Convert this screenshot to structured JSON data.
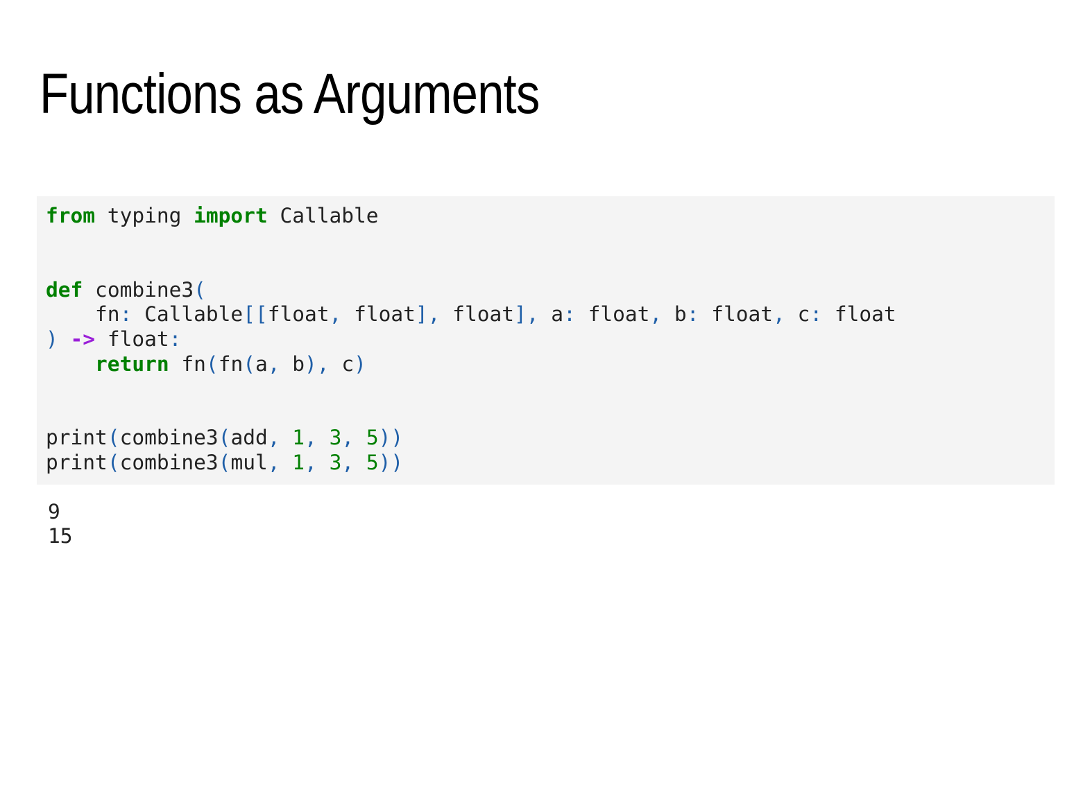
{
  "slide": {
    "title": "Functions as Arguments"
  },
  "code": {
    "lines": [
      [
        {
          "text": "from",
          "cls": "kw"
        },
        {
          "text": " typing ",
          "cls": ""
        },
        {
          "text": "import",
          "cls": "kw"
        },
        {
          "text": " Callable",
          "cls": ""
        }
      ],
      [],
      [],
      [
        {
          "text": "def",
          "cls": "kw"
        },
        {
          "text": " combine3",
          "cls": ""
        },
        {
          "text": "(",
          "cls": "p"
        }
      ],
      [
        {
          "text": "    fn",
          "cls": ""
        },
        {
          "text": ":",
          "cls": "p"
        },
        {
          "text": " Callable",
          "cls": ""
        },
        {
          "text": "[[",
          "cls": "p"
        },
        {
          "text": "float",
          "cls": ""
        },
        {
          "text": ",",
          "cls": "p"
        },
        {
          "text": " float",
          "cls": ""
        },
        {
          "text": "],",
          "cls": "p"
        },
        {
          "text": " float",
          "cls": ""
        },
        {
          "text": "],",
          "cls": "p"
        },
        {
          "text": " a",
          "cls": ""
        },
        {
          "text": ":",
          "cls": "p"
        },
        {
          "text": " float",
          "cls": ""
        },
        {
          "text": ",",
          "cls": "p"
        },
        {
          "text": " b",
          "cls": ""
        },
        {
          "text": ":",
          "cls": "p"
        },
        {
          "text": " float",
          "cls": ""
        },
        {
          "text": ",",
          "cls": "p"
        },
        {
          "text": " c",
          "cls": ""
        },
        {
          "text": ":",
          "cls": "p"
        },
        {
          "text": " float",
          "cls": ""
        }
      ],
      [
        {
          "text": ")",
          "cls": "p"
        },
        {
          "text": " ",
          "cls": ""
        },
        {
          "text": "->",
          "cls": "op"
        },
        {
          "text": " float",
          "cls": ""
        },
        {
          "text": ":",
          "cls": "p"
        }
      ],
      [
        {
          "text": "    ",
          "cls": ""
        },
        {
          "text": "return",
          "cls": "kw"
        },
        {
          "text": " fn",
          "cls": ""
        },
        {
          "text": "(",
          "cls": "p"
        },
        {
          "text": "fn",
          "cls": ""
        },
        {
          "text": "(",
          "cls": "p"
        },
        {
          "text": "a",
          "cls": ""
        },
        {
          "text": ",",
          "cls": "p"
        },
        {
          "text": " b",
          "cls": ""
        },
        {
          "text": "),",
          "cls": "p"
        },
        {
          "text": " c",
          "cls": ""
        },
        {
          "text": ")",
          "cls": "p"
        }
      ],
      [],
      [],
      [
        {
          "text": "print",
          "cls": ""
        },
        {
          "text": "(",
          "cls": "p"
        },
        {
          "text": "combine3",
          "cls": ""
        },
        {
          "text": "(",
          "cls": "p"
        },
        {
          "text": "add",
          "cls": ""
        },
        {
          "text": ",",
          "cls": "p"
        },
        {
          "text": " ",
          "cls": ""
        },
        {
          "text": "1",
          "cls": "num"
        },
        {
          "text": ",",
          "cls": "p"
        },
        {
          "text": " ",
          "cls": ""
        },
        {
          "text": "3",
          "cls": "num"
        },
        {
          "text": ",",
          "cls": "p"
        },
        {
          "text": " ",
          "cls": ""
        },
        {
          "text": "5",
          "cls": "num"
        },
        {
          "text": "))",
          "cls": "p"
        }
      ],
      [
        {
          "text": "print",
          "cls": ""
        },
        {
          "text": "(",
          "cls": "p"
        },
        {
          "text": "combine3",
          "cls": ""
        },
        {
          "text": "(",
          "cls": "p"
        },
        {
          "text": "mul",
          "cls": ""
        },
        {
          "text": ",",
          "cls": "p"
        },
        {
          "text": " ",
          "cls": ""
        },
        {
          "text": "1",
          "cls": "num"
        },
        {
          "text": ",",
          "cls": "p"
        },
        {
          "text": " ",
          "cls": ""
        },
        {
          "text": "3",
          "cls": "num"
        },
        {
          "text": ",",
          "cls": "p"
        },
        {
          "text": " ",
          "cls": ""
        },
        {
          "text": "5",
          "cls": "num"
        },
        {
          "text": "))",
          "cls": "p"
        }
      ]
    ]
  },
  "output": {
    "lines": [
      "9",
      "15"
    ]
  },
  "colors": {
    "keyword": "#008000",
    "operator": "#9a1fd8",
    "punctuation": "#1f5fa8",
    "number": "#008000",
    "code_background": "#f4f4f4",
    "text": "#222222"
  }
}
